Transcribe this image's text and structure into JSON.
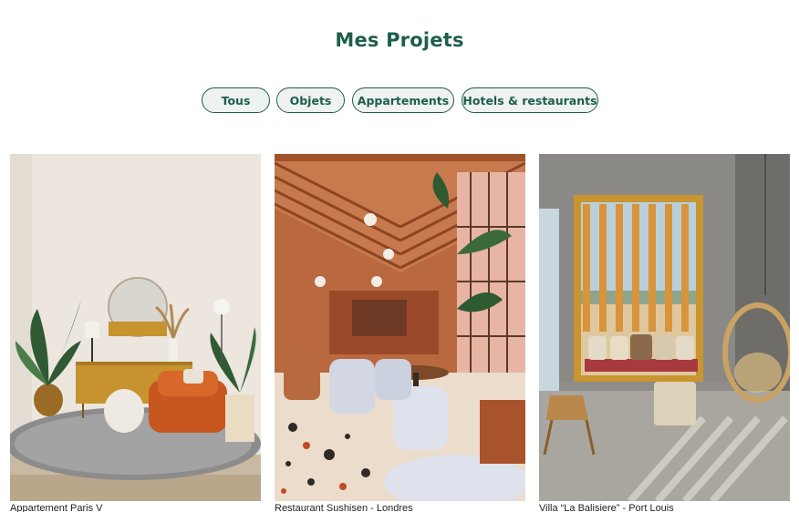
{
  "page": {
    "title": "Mes Projets"
  },
  "filters": [
    {
      "label": "Tous"
    },
    {
      "label": "Objets"
    },
    {
      "label": "Appartements"
    },
    {
      "label": "Hotels & restaurants"
    }
  ],
  "projects": [
    {
      "caption": "Appartement Paris V"
    },
    {
      "caption": "Restaurant Sushisen - Londres"
    },
    {
      "caption": "Villa “La Balisiere” - Port Louis"
    }
  ],
  "colors": {
    "accent": "#1e5e4c",
    "pill_bg": "#eef2f1"
  }
}
